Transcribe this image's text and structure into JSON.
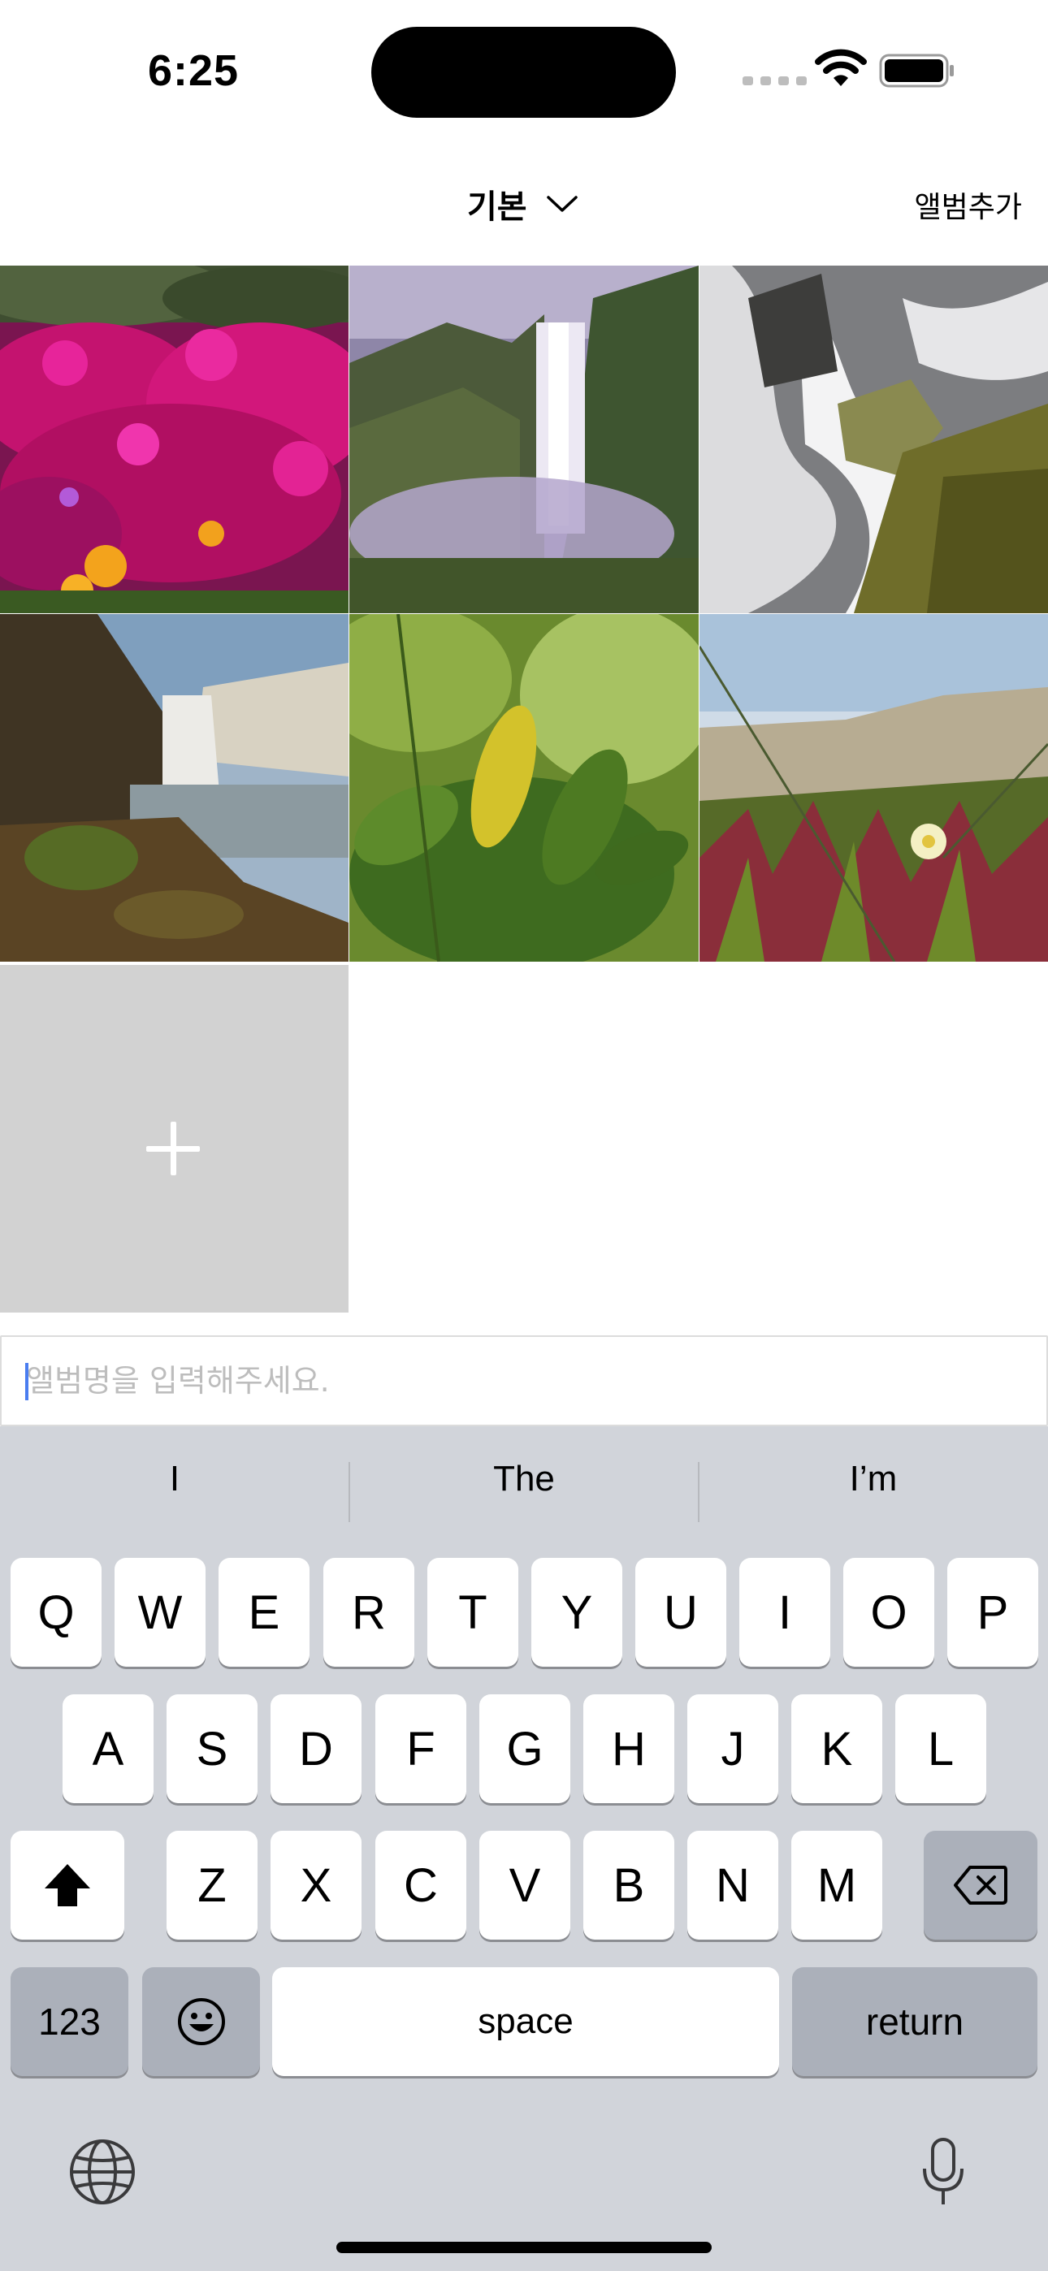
{
  "status_bar": {
    "time": "6:25"
  },
  "nav": {
    "title": "기본",
    "add_album_label": "앨범추가"
  },
  "photos": [
    {
      "name": "photo-pink-flowers"
    },
    {
      "name": "photo-tall-waterfall"
    },
    {
      "name": "photo-rocky-cascade"
    },
    {
      "name": "photo-waterfall-coast"
    },
    {
      "name": "photo-green-leaves"
    },
    {
      "name": "photo-ice-plant-dune"
    }
  ],
  "album_input": {
    "placeholder": "앨범명을 입력해주세요.",
    "value": ""
  },
  "keyboard": {
    "suggestions": [
      "I",
      "The",
      "I’m"
    ],
    "row1": [
      "Q",
      "W",
      "E",
      "R",
      "T",
      "Y",
      "U",
      "I",
      "O",
      "P"
    ],
    "row2": [
      "A",
      "S",
      "D",
      "F",
      "G",
      "H",
      "J",
      "K",
      "L"
    ],
    "row3": [
      "Z",
      "X",
      "C",
      "V",
      "B",
      "N",
      "M"
    ],
    "numbers_label": "123",
    "space_label": "space",
    "return_label": "return"
  },
  "colors": {
    "accent": "#4a7df0",
    "keyboard_bg": "#d1d4da",
    "add_tile_bg": "#d2d2d2"
  }
}
